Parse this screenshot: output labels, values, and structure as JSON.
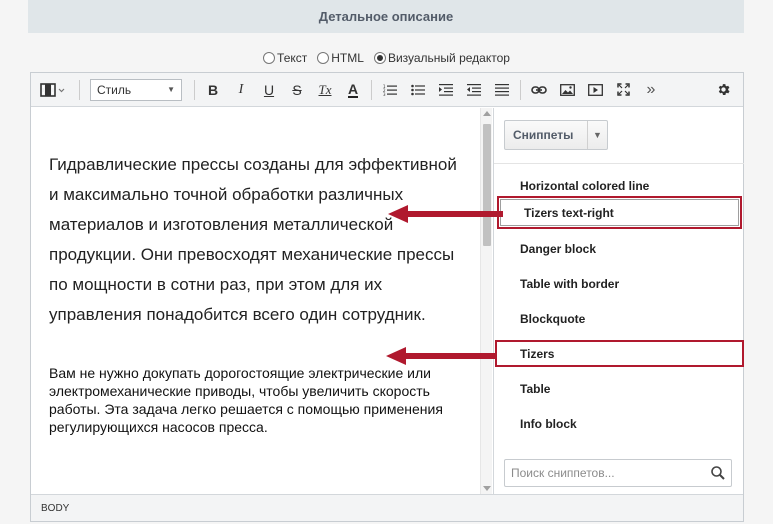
{
  "header": {
    "title": "Детальное описание"
  },
  "modes": [
    {
      "label": "Текст",
      "selected": false
    },
    {
      "label": "HTML",
      "selected": false
    },
    {
      "label": "Визуальный редактор",
      "selected": true
    }
  ],
  "toolbar": {
    "style_select": "Стиль",
    "bold": "B",
    "italic": "I",
    "underline": "U",
    "strike": "S",
    "remove_format": "Tx",
    "font_color": "A",
    "more": "»"
  },
  "content": {
    "paragraph1": "Гидравлические прессы созданы для эффективной и максимально точной обработки различных материалов и изготовления металлической продукции. Они превосходят механические прессы по мощности в сотни раз, при этом для их управления понадобится всего один сотрудник.",
    "paragraph2": "Вам не нужно докупать дорогостоящие электрические или электромеханические приводы, чтобы увеличить скорость работы. Эта задача легко решается с помощью применения регулирующихся насосов пресса."
  },
  "snippets": {
    "button_label": "Сниппеты",
    "items": [
      "Horizontal colored line",
      "Tizers text-right",
      "Danger block",
      "Table with border",
      "Blockquote",
      "Tizers",
      "Table",
      "Info block"
    ],
    "search_placeholder": "Поиск сниппетов..."
  },
  "statusbar": {
    "path": "BODY"
  },
  "colors": {
    "highlight": "#b0192e",
    "header_bg": "#e0e6e9"
  }
}
